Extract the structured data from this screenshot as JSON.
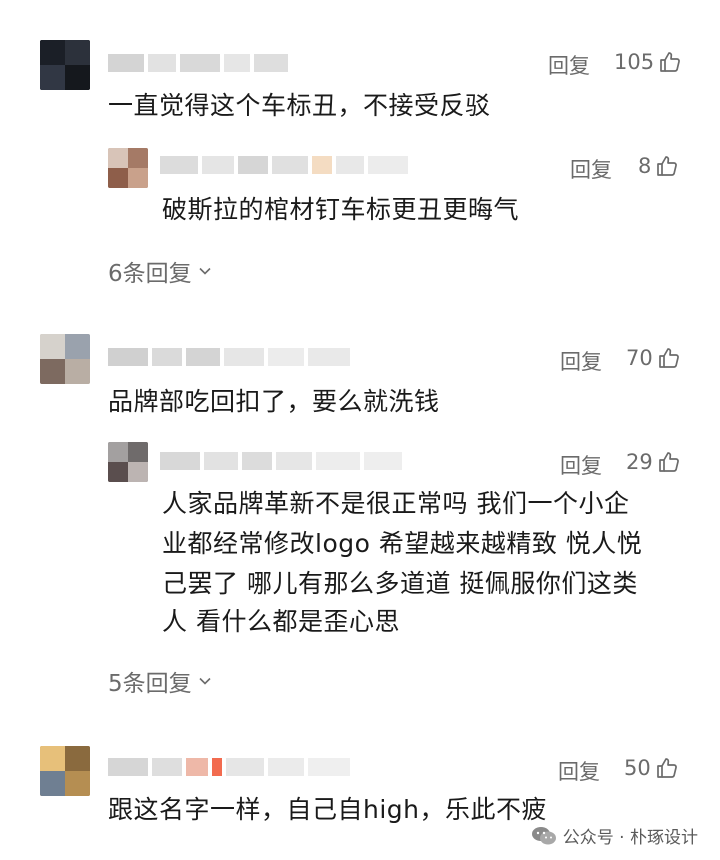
{
  "reply_label": "回复",
  "comments": [
    {
      "text": "一直觉得这个车标丑，不接受反驳",
      "likes": "105",
      "reply": {
        "text": "破斯拉的棺材钉车标更丑更晦气",
        "likes": "8"
      },
      "more_replies": "6条回复"
    },
    {
      "text": "品牌部吃回扣了，要么就洗钱",
      "likes": "70",
      "reply": {
        "text_lines": [
          "人家品牌革新不是很正常吗  我们一个小企",
          "业都经常修改logo 希望越来越精致 悦人悦",
          "己罢了  哪儿有那么多道道 挺佩服你们这类",
          "人 看什么都是歪心思"
        ],
        "likes": "29"
      },
      "more_replies": "5条回复"
    },
    {
      "text": "跟这名字一样，自己自high，乐此不疲",
      "likes": "50"
    }
  ],
  "watermark": "公众号 · 朴琢设计",
  "icons": {
    "like": "thumbs-up-icon",
    "expand": "chevron-down-icon",
    "watermark": "wechat-icon"
  },
  "colors": {
    "text": "#1a1a1a",
    "meta": "#6b6b6b"
  }
}
